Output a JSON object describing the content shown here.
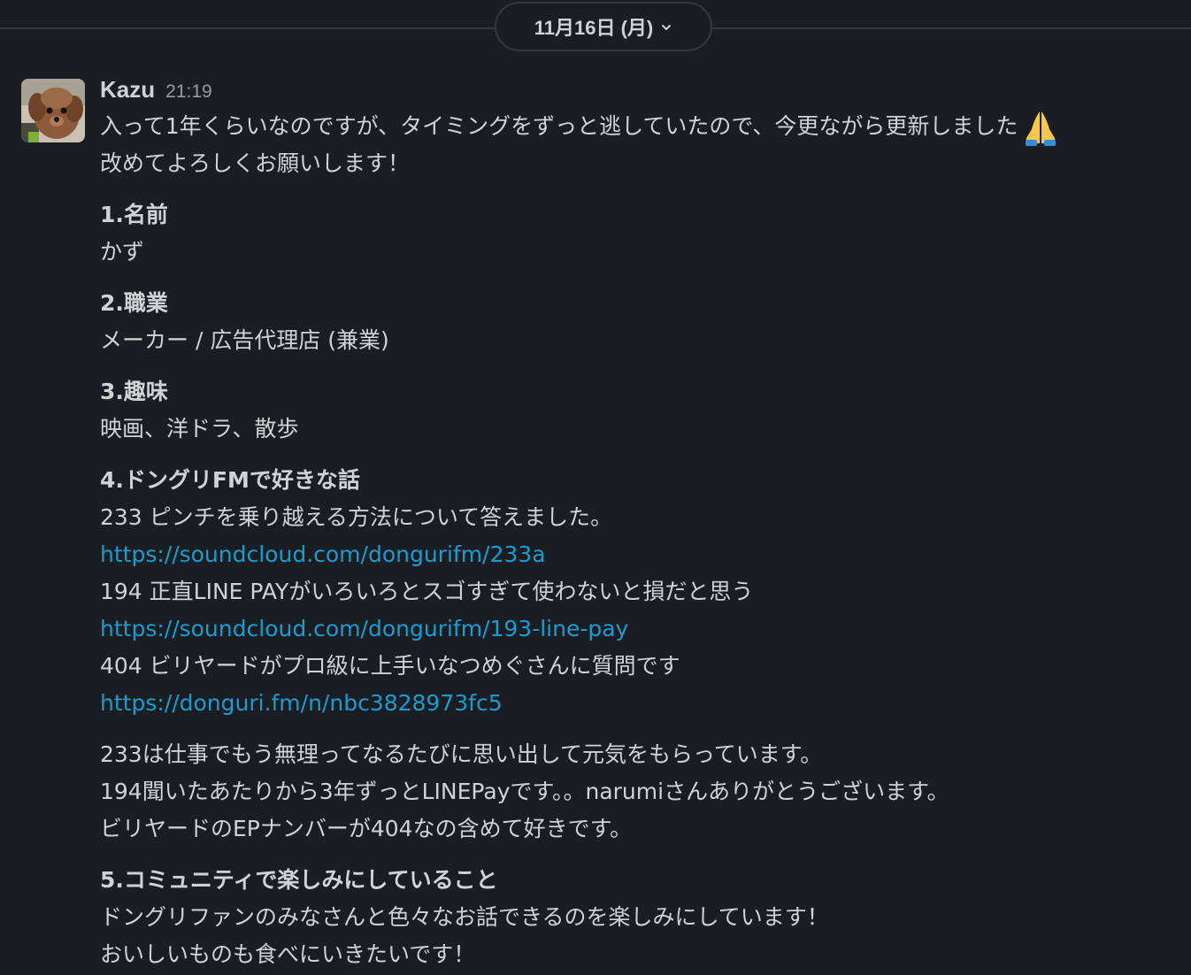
{
  "date_divider": {
    "label": "11月16日 (月)",
    "icon": "chevron-down-icon"
  },
  "message": {
    "author": "Kazu",
    "timestamp": "21:19",
    "intro_line1": "入って1年くらいなのですが、タイミングをずっと逃していたので、今更ながら更新しました",
    "intro_emoji": "pray-icon",
    "intro_line2": "改めてよろしくお願いします！",
    "q1_title": "1.名前",
    "q1_answer": "かず",
    "q2_title": "2.職業",
    "q2_answer": "メーカー / 広告代理店 (兼業)",
    "q3_title": "3.趣味",
    "q3_answer": "映画、洋ドラ、散歩",
    "q4_title": "4.ドングリFMで好きな話",
    "q4_ep1": "233 ピンチを乗り越える方法について答えました。",
    "q4_link1": "https://soundcloud.com/dongurifm/233a",
    "q4_ep2": "194 正直LINE PAYがいろいろとスゴすぎて使わないと損だと思う",
    "q4_link2": "https://soundcloud.com/dongurifm/193-line-pay",
    "q4_ep3": "404 ビリヤードがプロ級に上手いなつめぐさんに質問です",
    "q4_link3": "https://donguri.fm/n/nbc3828973fc5",
    "q4_comment1": "233は仕事でもう無理ってなるたびに思い出して元気をもらっています。",
    "q4_comment2": "194聞いたあたりから3年ずっとLINEPayです。。narumiさんありがとうございます。",
    "q4_comment3": "ビリヤードのEPナンバーが404なの含めて好きです。",
    "q5_title": "5.コミュニティで楽しみにしていること",
    "q5_answer1": "ドングリファンのみなさんと色々なお話できるのを楽しみにしています！",
    "q5_answer2": "おいしいものも食べにいきたいです！"
  },
  "colors": {
    "background": "#1a1d21",
    "text": "#d1d2d3",
    "muted": "#9a9b9d",
    "link": "#1d9bd1",
    "divider": "#35373b"
  }
}
